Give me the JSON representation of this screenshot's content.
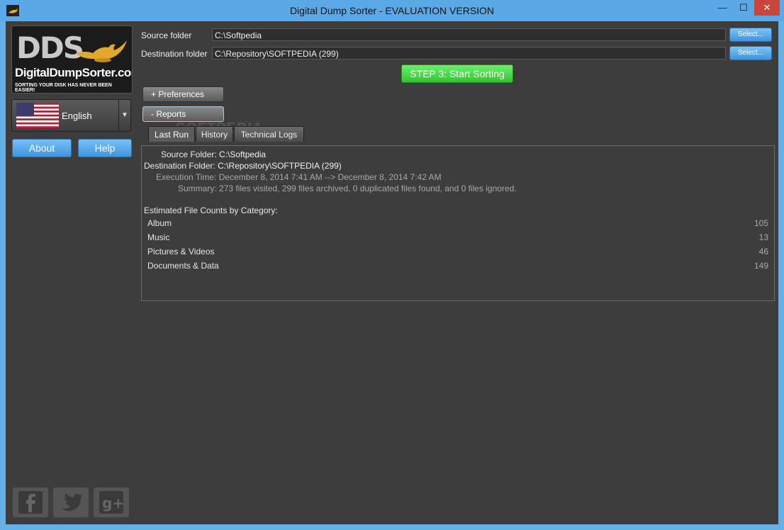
{
  "window": {
    "title": "Digital Dump Sorter - EVALUATION VERSION",
    "minimize_glyph": "—",
    "maximize_glyph": "☐",
    "close_glyph": "✕"
  },
  "sidebar": {
    "logo_letters": "DDS",
    "logo_site": "DigitalDumpSorter.com",
    "logo_tagline": "SORTING YOUR DISK HAS NEVER BEEN EASIER!",
    "language": "English",
    "about_label": "About",
    "help_label": "Help",
    "social_icons": [
      "facebook-icon",
      "twitter-icon",
      "google-plus-icon"
    ]
  },
  "form": {
    "source_label": "Source folder",
    "source_value": "C:\\Softpedia",
    "destination_label": "Destination folder",
    "destination_value": "C:\\Repository\\SOFTPEDIA (299)",
    "select_label": "Select...",
    "start_label": "STEP 3: Start Sorting"
  },
  "sections": {
    "preferences_label": "+ Preferences",
    "reports_label": "- Reports"
  },
  "tabs": [
    "Last Run",
    "History",
    "Technical Logs"
  ],
  "watermark": "SOFTPEDIA",
  "report": {
    "source_key": "Source Folder:",
    "source_val": "C:\\Softpedia",
    "dest_key": "Destination Folder:",
    "dest_val": "C:\\Repository\\SOFTPEDIA (299)",
    "exec_key": "Execution Time:",
    "exec_val": "December 8, 2014 7:41 AM --> December 8, 2014 7:42 AM",
    "summary_key": "Summary:",
    "summary_val": "273 files visited, 299 files archived, 0 duplicated files found, and 0 files ignored.",
    "counts_heading": "Estimated File Counts by Category:",
    "categories": [
      {
        "name": "Album",
        "count": "105"
      },
      {
        "name": "Music",
        "count": "13"
      },
      {
        "name": "Pictures & Videos",
        "count": "46"
      },
      {
        "name": "Documents & Data",
        "count": "149"
      }
    ]
  },
  "colors": {
    "titlebar": "#5aa9e6",
    "client_bg": "#3d3d3d",
    "start_green": "#3fd53f",
    "select_blue": "#4aa3e8"
  }
}
